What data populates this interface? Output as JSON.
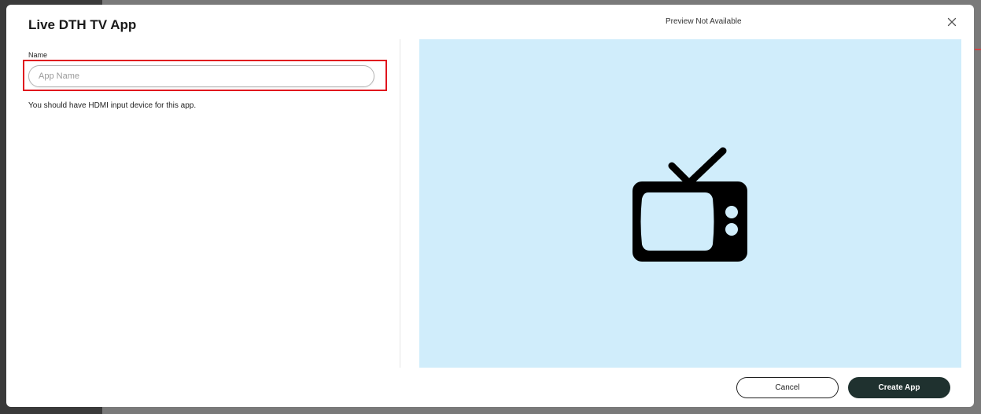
{
  "modal": {
    "title": "Live DTH TV App",
    "preview_label": "Preview Not Available",
    "close_icon": "close-icon",
    "form": {
      "name_label": "Name",
      "name_value": "",
      "name_placeholder": "App Name",
      "hint": "You should have HDMI input device for this app."
    },
    "preview": {
      "icon": "tv-icon",
      "background_color": "#d0edfb"
    },
    "footer": {
      "cancel_label": "Cancel",
      "create_label": "Create App"
    }
  },
  "colors": {
    "primary_button": "#1f312f",
    "highlight_border": "#e0141e"
  }
}
